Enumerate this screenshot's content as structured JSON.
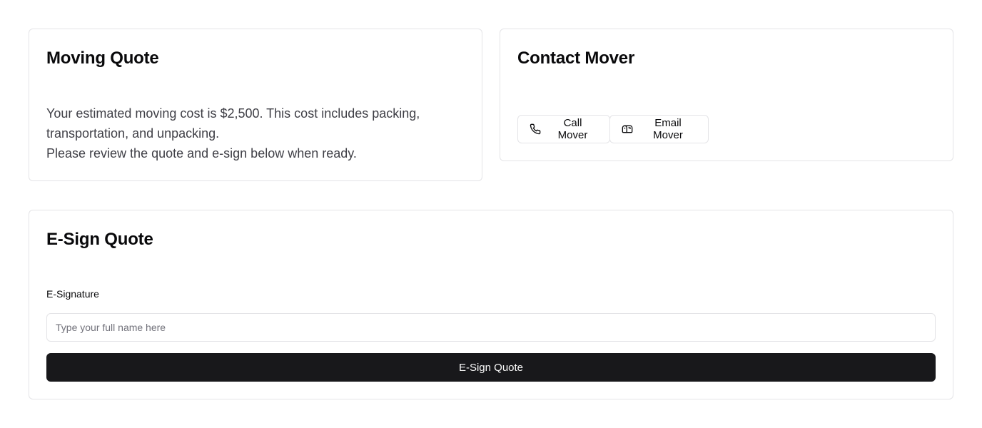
{
  "quote_card": {
    "title": "Moving Quote",
    "lines": [
      "Your estimated moving cost is $2,500. This cost includes packing,",
      "transportation, and unpacking.",
      "Please review the quote and e-sign below when ready."
    ]
  },
  "contact_card": {
    "title": "Contact Mover",
    "call_button": {
      "label": "Call Mover",
      "icon": "phone-icon"
    },
    "email_button": {
      "label": "Email Mover",
      "icon": "mailbox-icon"
    }
  },
  "esign_card": {
    "title": "E-Sign Quote",
    "field_label": "E-Signature",
    "input": {
      "placeholder": "Type your full name here",
      "value": ""
    },
    "submit_label": "E-Sign Quote"
  },
  "colors": {
    "primary": "#18181b",
    "border": "#e4e4e7",
    "muted_text": "#3f3f46",
    "placeholder": "#71717a"
  }
}
